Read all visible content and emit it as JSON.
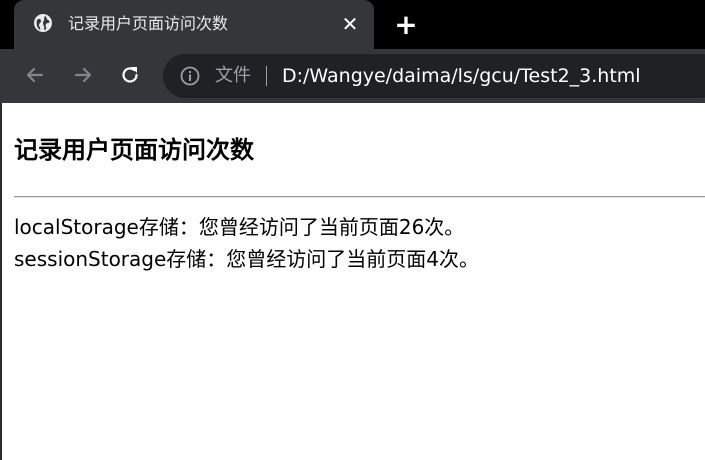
{
  "browser": {
    "tab": {
      "title": "记录用户页面访问次数",
      "close_glyph": "✕",
      "icon": "globe-icon"
    },
    "new_tab_glyph": "+",
    "toolbar": {
      "back_icon": "arrow-left-icon",
      "forward_icon": "arrow-right-icon",
      "reload_icon": "reload-icon",
      "site_info_icon": "info-icon",
      "scheme_label": "文件",
      "url": "D:/Wangye/daima/ls/gcu/Test2_3.html"
    }
  },
  "page": {
    "heading": "记录用户页面访问次数",
    "local_line": "localStorage存储：您曾经访问了当前页面26次。",
    "session_line": "sessionStorage存储：您曾经访问了当前页面4次。"
  },
  "colors": {
    "tabstrip": "#000000",
    "tab_active": "#35363a",
    "toolbar": "#35363a",
    "omnibox": "#202124",
    "text_light": "#e8eaed",
    "muted": "#9aa0a6",
    "page_bg": "#ffffff"
  }
}
